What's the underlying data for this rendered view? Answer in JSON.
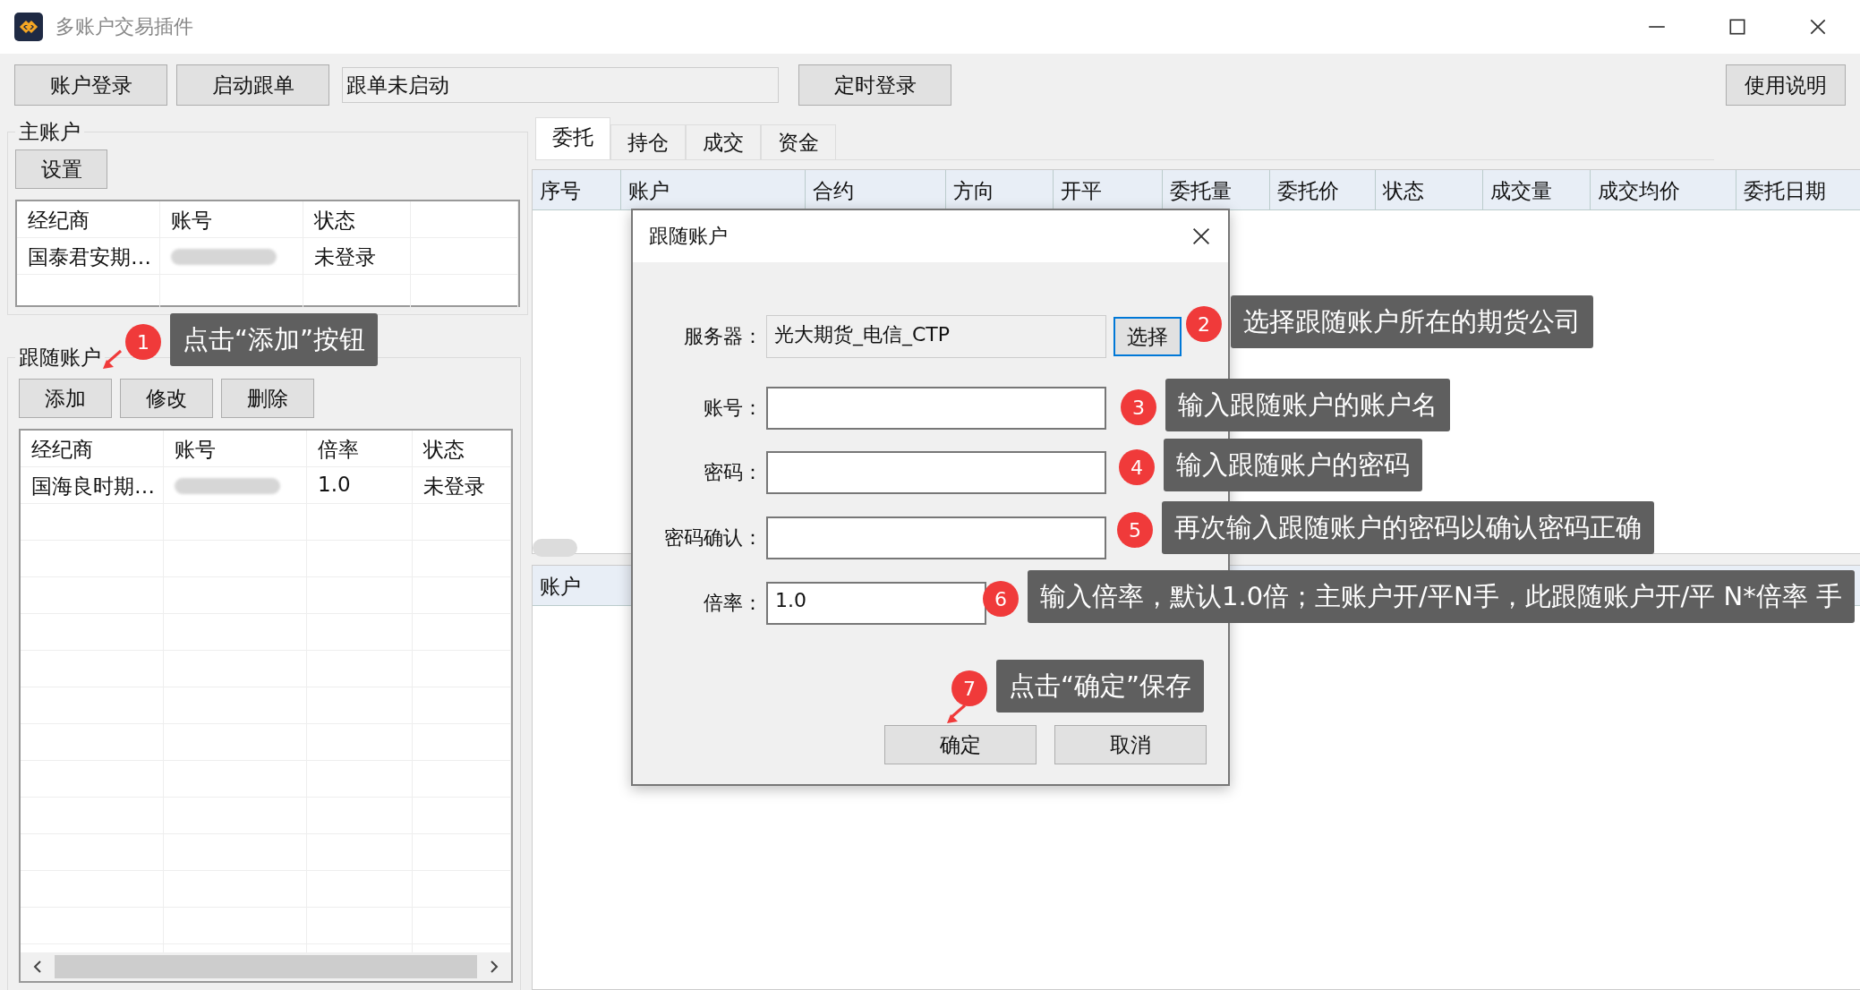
{
  "window": {
    "title": "多账户交易插件"
  },
  "toolbar": {
    "buttons": [
      "账户登录",
      "启动跟单"
    ],
    "status": "跟单未启动",
    "timed_login": "定时登录",
    "help": "使用说明"
  },
  "main_account": {
    "title": "主账户",
    "button": "设置",
    "columns": [
      "经纪商",
      "账号",
      "状态"
    ],
    "rows": [
      {
        "broker": "国泰君安期…",
        "account_hidden": true,
        "status": "未登录"
      }
    ]
  },
  "follow_accounts": {
    "title": "跟随账户",
    "buttons": [
      "添加",
      "修改",
      "删除"
    ],
    "columns": [
      "经纪商",
      "账号",
      "倍率",
      "状态"
    ],
    "rows": [
      {
        "broker": "国海良时期…",
        "account_hidden": true,
        "ratio": "1.0",
        "status": "未登录"
      }
    ]
  },
  "tabs": [
    {
      "label": "委托",
      "selected": true
    },
    {
      "label": "持仓",
      "selected": false
    },
    {
      "label": "成交",
      "selected": false
    },
    {
      "label": "资金",
      "selected": false
    }
  ],
  "orders": {
    "columns": [
      "序号",
      "账户",
      "合约",
      "方向",
      "开平",
      "委托量",
      "委托价",
      "状态",
      "成交量",
      "成交均价",
      "委托日期"
    ]
  },
  "lower_table": {
    "columns": [
      "账户"
    ]
  },
  "dialog": {
    "title": "跟随账户",
    "fields": [
      {
        "label": "服务器：",
        "kind": "readonly",
        "value": "光大期货_电信_CTP",
        "button": "选择"
      },
      {
        "label": "账号：",
        "kind": "input"
      },
      {
        "label": "密码：",
        "kind": "input"
      },
      {
        "label": "密码确认：",
        "kind": "input"
      },
      {
        "label": "倍率：",
        "kind": "short",
        "value": "1.0"
      }
    ],
    "buttons": [
      "确定",
      "取消"
    ]
  },
  "callouts": [
    {
      "number": "1",
      "text": "点击“添加”按钮"
    },
    {
      "number": "2",
      "text": "选择跟随账户所在的期货公司"
    },
    {
      "number": "3",
      "text": "输入跟随账户的账户名"
    },
    {
      "number": "4",
      "text": "输入跟随账户的密码"
    },
    {
      "number": "5",
      "text": "再次输入跟随账户的密码以确认密码正确"
    },
    {
      "number": "6",
      "text": "输入倍率，默认1.0倍；主账户开/平N手，此跟随账户开/平 N*倍率 手"
    },
    {
      "number": "7",
      "text": "点击“确定”保存"
    }
  ]
}
